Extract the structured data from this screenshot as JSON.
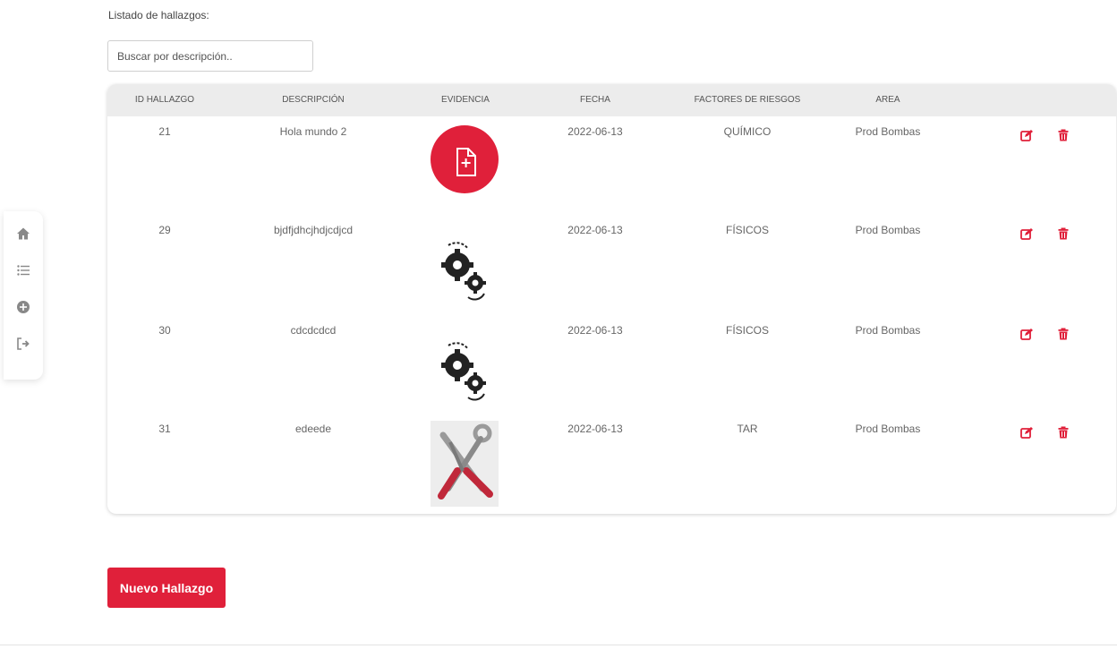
{
  "listado_label": "Listado de hallazgos:",
  "search": {
    "placeholder": "Buscar por descripción.."
  },
  "table": {
    "headers": [
      "ID HALLAZGO",
      "DESCRIPCIÓN",
      "EVIDENCIA",
      "FECHA",
      "FACTORES DE RIESGOS",
      "AREA"
    ],
    "rows": [
      {
        "id": "21",
        "descripcion": "Hola mundo 2",
        "evidencia": "file-plus-icon",
        "fecha": "2022-06-13",
        "factor": "QUÍMICO",
        "area": "Prod Bombas"
      },
      {
        "id": "29",
        "descripcion": "bjdfjdhcjhdjcdjcd",
        "evidencia": "gears-icon",
        "fecha": "2022-06-13",
        "factor": "FÍSICOS",
        "area": "Prod Bombas"
      },
      {
        "id": "30",
        "descripcion": "cdcdcdcd",
        "evidencia": "gears-icon",
        "fecha": "2022-06-13",
        "factor": "FÍSICOS",
        "area": "Prod Bombas"
      },
      {
        "id": "31",
        "descripcion": "edeede",
        "evidencia": "tools-image",
        "fecha": "2022-06-13",
        "factor": "TAR",
        "area": "Prod Bombas"
      }
    ]
  },
  "actions": {
    "edit_icon": "edit-icon",
    "delete_icon": "trash-icon"
  },
  "nav": {
    "items": [
      "home-icon",
      "list-icon",
      "add-circle-icon",
      "logout-icon"
    ]
  },
  "buttons": {
    "nuevo": "Nuevo Hallazgo"
  },
  "colors": {
    "accent": "#e0203a",
    "header_bg": "#ececec",
    "nav_icon": "#888888"
  }
}
